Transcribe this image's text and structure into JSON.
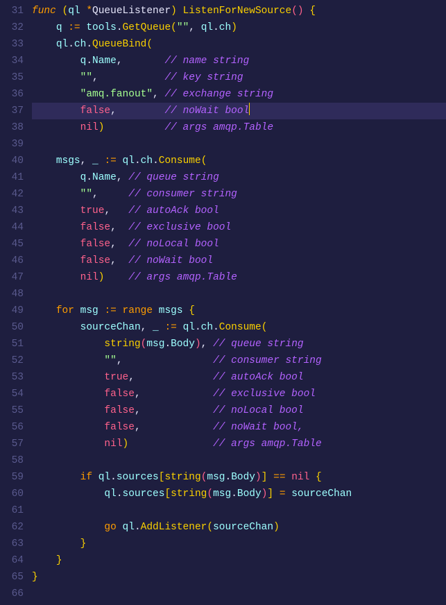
{
  "gutter": {
    "start": 31,
    "end": 66,
    "highlight_line": 37
  },
  "lines": {
    "31": [
      {
        "cls": "kw",
        "t": "func"
      },
      {
        "cls": "plain",
        "t": " "
      },
      {
        "cls": "paren",
        "t": "("
      },
      {
        "cls": "ident",
        "t": "ql"
      },
      {
        "cls": "plain",
        "t": " "
      },
      {
        "cls": "op",
        "t": "*"
      },
      {
        "cls": "type",
        "t": "QueueListener"
      },
      {
        "cls": "paren",
        "t": ")"
      },
      {
        "cls": "plain",
        "t": " "
      },
      {
        "cls": "declfunc",
        "t": "ListenForNewSource"
      },
      {
        "cls": "paren2",
        "t": "()"
      },
      {
        "cls": "plain",
        "t": " "
      },
      {
        "cls": "brace",
        "t": "{"
      }
    ],
    "32": [
      {
        "cls": "plain",
        "t": "    "
      },
      {
        "cls": "ident",
        "t": "q"
      },
      {
        "cls": "plain",
        "t": " "
      },
      {
        "cls": "op",
        "t": ":="
      },
      {
        "cls": "plain",
        "t": " "
      },
      {
        "cls": "ident",
        "t": "tools"
      },
      {
        "cls": "dot",
        "t": "."
      },
      {
        "cls": "call",
        "t": "GetQueue"
      },
      {
        "cls": "paren",
        "t": "("
      },
      {
        "cls": "str",
        "t": "\"\""
      },
      {
        "cls": "punct",
        "t": ", "
      },
      {
        "cls": "ident",
        "t": "ql"
      },
      {
        "cls": "dot",
        "t": "."
      },
      {
        "cls": "ident",
        "t": "ch"
      },
      {
        "cls": "paren",
        "t": ")"
      }
    ],
    "33": [
      {
        "cls": "plain",
        "t": "    "
      },
      {
        "cls": "ident",
        "t": "ql"
      },
      {
        "cls": "dot",
        "t": "."
      },
      {
        "cls": "ident",
        "t": "ch"
      },
      {
        "cls": "dot",
        "t": "."
      },
      {
        "cls": "call",
        "t": "QueueBind"
      },
      {
        "cls": "paren",
        "t": "("
      }
    ],
    "34": [
      {
        "cls": "plain",
        "t": "        "
      },
      {
        "cls": "ident",
        "t": "q"
      },
      {
        "cls": "dot",
        "t": "."
      },
      {
        "cls": "ident",
        "t": "Name"
      },
      {
        "cls": "punct",
        "t": ","
      },
      {
        "cls": "plain",
        "t": "       "
      },
      {
        "cls": "comment",
        "t": "// name string"
      }
    ],
    "35": [
      {
        "cls": "plain",
        "t": "        "
      },
      {
        "cls": "str",
        "t": "\"\""
      },
      {
        "cls": "punct",
        "t": ","
      },
      {
        "cls": "plain",
        "t": "           "
      },
      {
        "cls": "comment",
        "t": "// key string"
      }
    ],
    "36": [
      {
        "cls": "plain",
        "t": "        "
      },
      {
        "cls": "str",
        "t": "\"amq.fanout\""
      },
      {
        "cls": "punct",
        "t": ","
      },
      {
        "cls": "plain",
        "t": " "
      },
      {
        "cls": "comment",
        "t": "// exchange string"
      }
    ],
    "37": [
      {
        "cls": "plain",
        "t": "        "
      },
      {
        "cls": "const",
        "t": "false"
      },
      {
        "cls": "punct",
        "t": ","
      },
      {
        "cls": "plain",
        "t": "        "
      },
      {
        "cls": "comment",
        "t": "// noWait bool"
      }
    ],
    "38": [
      {
        "cls": "plain",
        "t": "        "
      },
      {
        "cls": "const",
        "t": "nil"
      },
      {
        "cls": "paren",
        "t": ")"
      },
      {
        "cls": "plain",
        "t": "          "
      },
      {
        "cls": "comment",
        "t": "// args amqp.Table"
      }
    ],
    "39": [],
    "40": [
      {
        "cls": "plain",
        "t": "    "
      },
      {
        "cls": "ident",
        "t": "msgs"
      },
      {
        "cls": "punct",
        "t": ", "
      },
      {
        "cls": "ident",
        "t": "_"
      },
      {
        "cls": "plain",
        "t": " "
      },
      {
        "cls": "op",
        "t": ":="
      },
      {
        "cls": "plain",
        "t": " "
      },
      {
        "cls": "ident",
        "t": "ql"
      },
      {
        "cls": "dot",
        "t": "."
      },
      {
        "cls": "ident",
        "t": "ch"
      },
      {
        "cls": "dot",
        "t": "."
      },
      {
        "cls": "call",
        "t": "Consume"
      },
      {
        "cls": "paren",
        "t": "("
      }
    ],
    "41": [
      {
        "cls": "plain",
        "t": "        "
      },
      {
        "cls": "ident",
        "t": "q"
      },
      {
        "cls": "dot",
        "t": "."
      },
      {
        "cls": "ident",
        "t": "Name"
      },
      {
        "cls": "punct",
        "t": ","
      },
      {
        "cls": "plain",
        "t": " "
      },
      {
        "cls": "comment",
        "t": "// queue string"
      }
    ],
    "42": [
      {
        "cls": "plain",
        "t": "        "
      },
      {
        "cls": "str",
        "t": "\"\""
      },
      {
        "cls": "punct",
        "t": ","
      },
      {
        "cls": "plain",
        "t": "     "
      },
      {
        "cls": "comment",
        "t": "// consumer string"
      }
    ],
    "43": [
      {
        "cls": "plain",
        "t": "        "
      },
      {
        "cls": "const",
        "t": "true"
      },
      {
        "cls": "punct",
        "t": ","
      },
      {
        "cls": "plain",
        "t": "   "
      },
      {
        "cls": "comment",
        "t": "// autoAck bool"
      }
    ],
    "44": [
      {
        "cls": "plain",
        "t": "        "
      },
      {
        "cls": "const",
        "t": "false"
      },
      {
        "cls": "punct",
        "t": ","
      },
      {
        "cls": "plain",
        "t": "  "
      },
      {
        "cls": "comment",
        "t": "// exclusive bool"
      }
    ],
    "45": [
      {
        "cls": "plain",
        "t": "        "
      },
      {
        "cls": "const",
        "t": "false"
      },
      {
        "cls": "punct",
        "t": ","
      },
      {
        "cls": "plain",
        "t": "  "
      },
      {
        "cls": "comment",
        "t": "// noLocal bool"
      }
    ],
    "46": [
      {
        "cls": "plain",
        "t": "        "
      },
      {
        "cls": "const",
        "t": "false"
      },
      {
        "cls": "punct",
        "t": ","
      },
      {
        "cls": "plain",
        "t": "  "
      },
      {
        "cls": "comment",
        "t": "// noWait bool"
      }
    ],
    "47": [
      {
        "cls": "plain",
        "t": "        "
      },
      {
        "cls": "const",
        "t": "nil"
      },
      {
        "cls": "paren",
        "t": ")"
      },
      {
        "cls": "plain",
        "t": "    "
      },
      {
        "cls": "comment",
        "t": "// args amqp.Table"
      }
    ],
    "48": [],
    "49": [
      {
        "cls": "plain",
        "t": "    "
      },
      {
        "cls": "kw2",
        "t": "for"
      },
      {
        "cls": "plain",
        "t": " "
      },
      {
        "cls": "ident",
        "t": "msg"
      },
      {
        "cls": "plain",
        "t": " "
      },
      {
        "cls": "op",
        "t": ":="
      },
      {
        "cls": "plain",
        "t": " "
      },
      {
        "cls": "kw2",
        "t": "range"
      },
      {
        "cls": "plain",
        "t": " "
      },
      {
        "cls": "ident",
        "t": "msgs"
      },
      {
        "cls": "plain",
        "t": " "
      },
      {
        "cls": "brace",
        "t": "{"
      }
    ],
    "50": [
      {
        "cls": "plain",
        "t": "        "
      },
      {
        "cls": "ident",
        "t": "sourceChan"
      },
      {
        "cls": "punct",
        "t": ", "
      },
      {
        "cls": "ident",
        "t": "_"
      },
      {
        "cls": "plain",
        "t": " "
      },
      {
        "cls": "op",
        "t": ":="
      },
      {
        "cls": "plain",
        "t": " "
      },
      {
        "cls": "ident",
        "t": "ql"
      },
      {
        "cls": "dot",
        "t": "."
      },
      {
        "cls": "ident",
        "t": "ch"
      },
      {
        "cls": "dot",
        "t": "."
      },
      {
        "cls": "call",
        "t": "Consume"
      },
      {
        "cls": "paren",
        "t": "("
      }
    ],
    "51": [
      {
        "cls": "plain",
        "t": "            "
      },
      {
        "cls": "call",
        "t": "string"
      },
      {
        "cls": "paren2",
        "t": "("
      },
      {
        "cls": "ident",
        "t": "msg"
      },
      {
        "cls": "dot",
        "t": "."
      },
      {
        "cls": "ident",
        "t": "Body"
      },
      {
        "cls": "paren2",
        "t": ")"
      },
      {
        "cls": "punct",
        "t": ","
      },
      {
        "cls": "plain",
        "t": " "
      },
      {
        "cls": "comment",
        "t": "// queue string"
      }
    ],
    "52": [
      {
        "cls": "plain",
        "t": "            "
      },
      {
        "cls": "str",
        "t": "\"\""
      },
      {
        "cls": "punct",
        "t": ","
      },
      {
        "cls": "plain",
        "t": "               "
      },
      {
        "cls": "comment",
        "t": "// consumer string"
      }
    ],
    "53": [
      {
        "cls": "plain",
        "t": "            "
      },
      {
        "cls": "const",
        "t": "true"
      },
      {
        "cls": "punct",
        "t": ","
      },
      {
        "cls": "plain",
        "t": "             "
      },
      {
        "cls": "comment",
        "t": "// autoAck bool"
      }
    ],
    "54": [
      {
        "cls": "plain",
        "t": "            "
      },
      {
        "cls": "const",
        "t": "false"
      },
      {
        "cls": "punct",
        "t": ","
      },
      {
        "cls": "plain",
        "t": "            "
      },
      {
        "cls": "comment",
        "t": "// exclusive bool"
      }
    ],
    "55": [
      {
        "cls": "plain",
        "t": "            "
      },
      {
        "cls": "const",
        "t": "false"
      },
      {
        "cls": "punct",
        "t": ","
      },
      {
        "cls": "plain",
        "t": "            "
      },
      {
        "cls": "comment",
        "t": "// noLocal bool"
      }
    ],
    "56": [
      {
        "cls": "plain",
        "t": "            "
      },
      {
        "cls": "const",
        "t": "false"
      },
      {
        "cls": "punct",
        "t": ","
      },
      {
        "cls": "plain",
        "t": "            "
      },
      {
        "cls": "comment",
        "t": "// noWait bool,"
      }
    ],
    "57": [
      {
        "cls": "plain",
        "t": "            "
      },
      {
        "cls": "const",
        "t": "nil"
      },
      {
        "cls": "paren",
        "t": ")"
      },
      {
        "cls": "plain",
        "t": "              "
      },
      {
        "cls": "comment",
        "t": "// args amqp.Table"
      }
    ],
    "58": [],
    "59": [
      {
        "cls": "plain",
        "t": "        "
      },
      {
        "cls": "kw2",
        "t": "if"
      },
      {
        "cls": "plain",
        "t": " "
      },
      {
        "cls": "ident",
        "t": "ql"
      },
      {
        "cls": "dot",
        "t": "."
      },
      {
        "cls": "ident",
        "t": "sources"
      },
      {
        "cls": "paren",
        "t": "["
      },
      {
        "cls": "call",
        "t": "string"
      },
      {
        "cls": "paren2",
        "t": "("
      },
      {
        "cls": "ident",
        "t": "msg"
      },
      {
        "cls": "dot",
        "t": "."
      },
      {
        "cls": "ident",
        "t": "Body"
      },
      {
        "cls": "paren2",
        "t": ")"
      },
      {
        "cls": "paren",
        "t": "]"
      },
      {
        "cls": "plain",
        "t": " "
      },
      {
        "cls": "op",
        "t": "=="
      },
      {
        "cls": "plain",
        "t": " "
      },
      {
        "cls": "const",
        "t": "nil"
      },
      {
        "cls": "plain",
        "t": " "
      },
      {
        "cls": "brace",
        "t": "{"
      }
    ],
    "60": [
      {
        "cls": "plain",
        "t": "            "
      },
      {
        "cls": "ident",
        "t": "ql"
      },
      {
        "cls": "dot",
        "t": "."
      },
      {
        "cls": "ident",
        "t": "sources"
      },
      {
        "cls": "paren",
        "t": "["
      },
      {
        "cls": "call",
        "t": "string"
      },
      {
        "cls": "paren2",
        "t": "("
      },
      {
        "cls": "ident",
        "t": "msg"
      },
      {
        "cls": "dot",
        "t": "."
      },
      {
        "cls": "ident",
        "t": "Body"
      },
      {
        "cls": "paren2",
        "t": ")"
      },
      {
        "cls": "paren",
        "t": "]"
      },
      {
        "cls": "plain",
        "t": " "
      },
      {
        "cls": "op",
        "t": "="
      },
      {
        "cls": "plain",
        "t": " "
      },
      {
        "cls": "ident",
        "t": "sourceChan"
      }
    ],
    "61": [],
    "62": [
      {
        "cls": "plain",
        "t": "            "
      },
      {
        "cls": "kw2",
        "t": "go"
      },
      {
        "cls": "plain",
        "t": " "
      },
      {
        "cls": "ident",
        "t": "ql"
      },
      {
        "cls": "dot",
        "t": "."
      },
      {
        "cls": "call",
        "t": "AddListener"
      },
      {
        "cls": "paren",
        "t": "("
      },
      {
        "cls": "ident",
        "t": "sourceChan"
      },
      {
        "cls": "paren",
        "t": ")"
      }
    ],
    "63": [
      {
        "cls": "plain",
        "t": "        "
      },
      {
        "cls": "brace",
        "t": "}"
      }
    ],
    "64": [
      {
        "cls": "plain",
        "t": "    "
      },
      {
        "cls": "brace",
        "t": "}"
      }
    ],
    "65": [
      {
        "cls": "brace",
        "t": "}"
      }
    ],
    "66": []
  }
}
